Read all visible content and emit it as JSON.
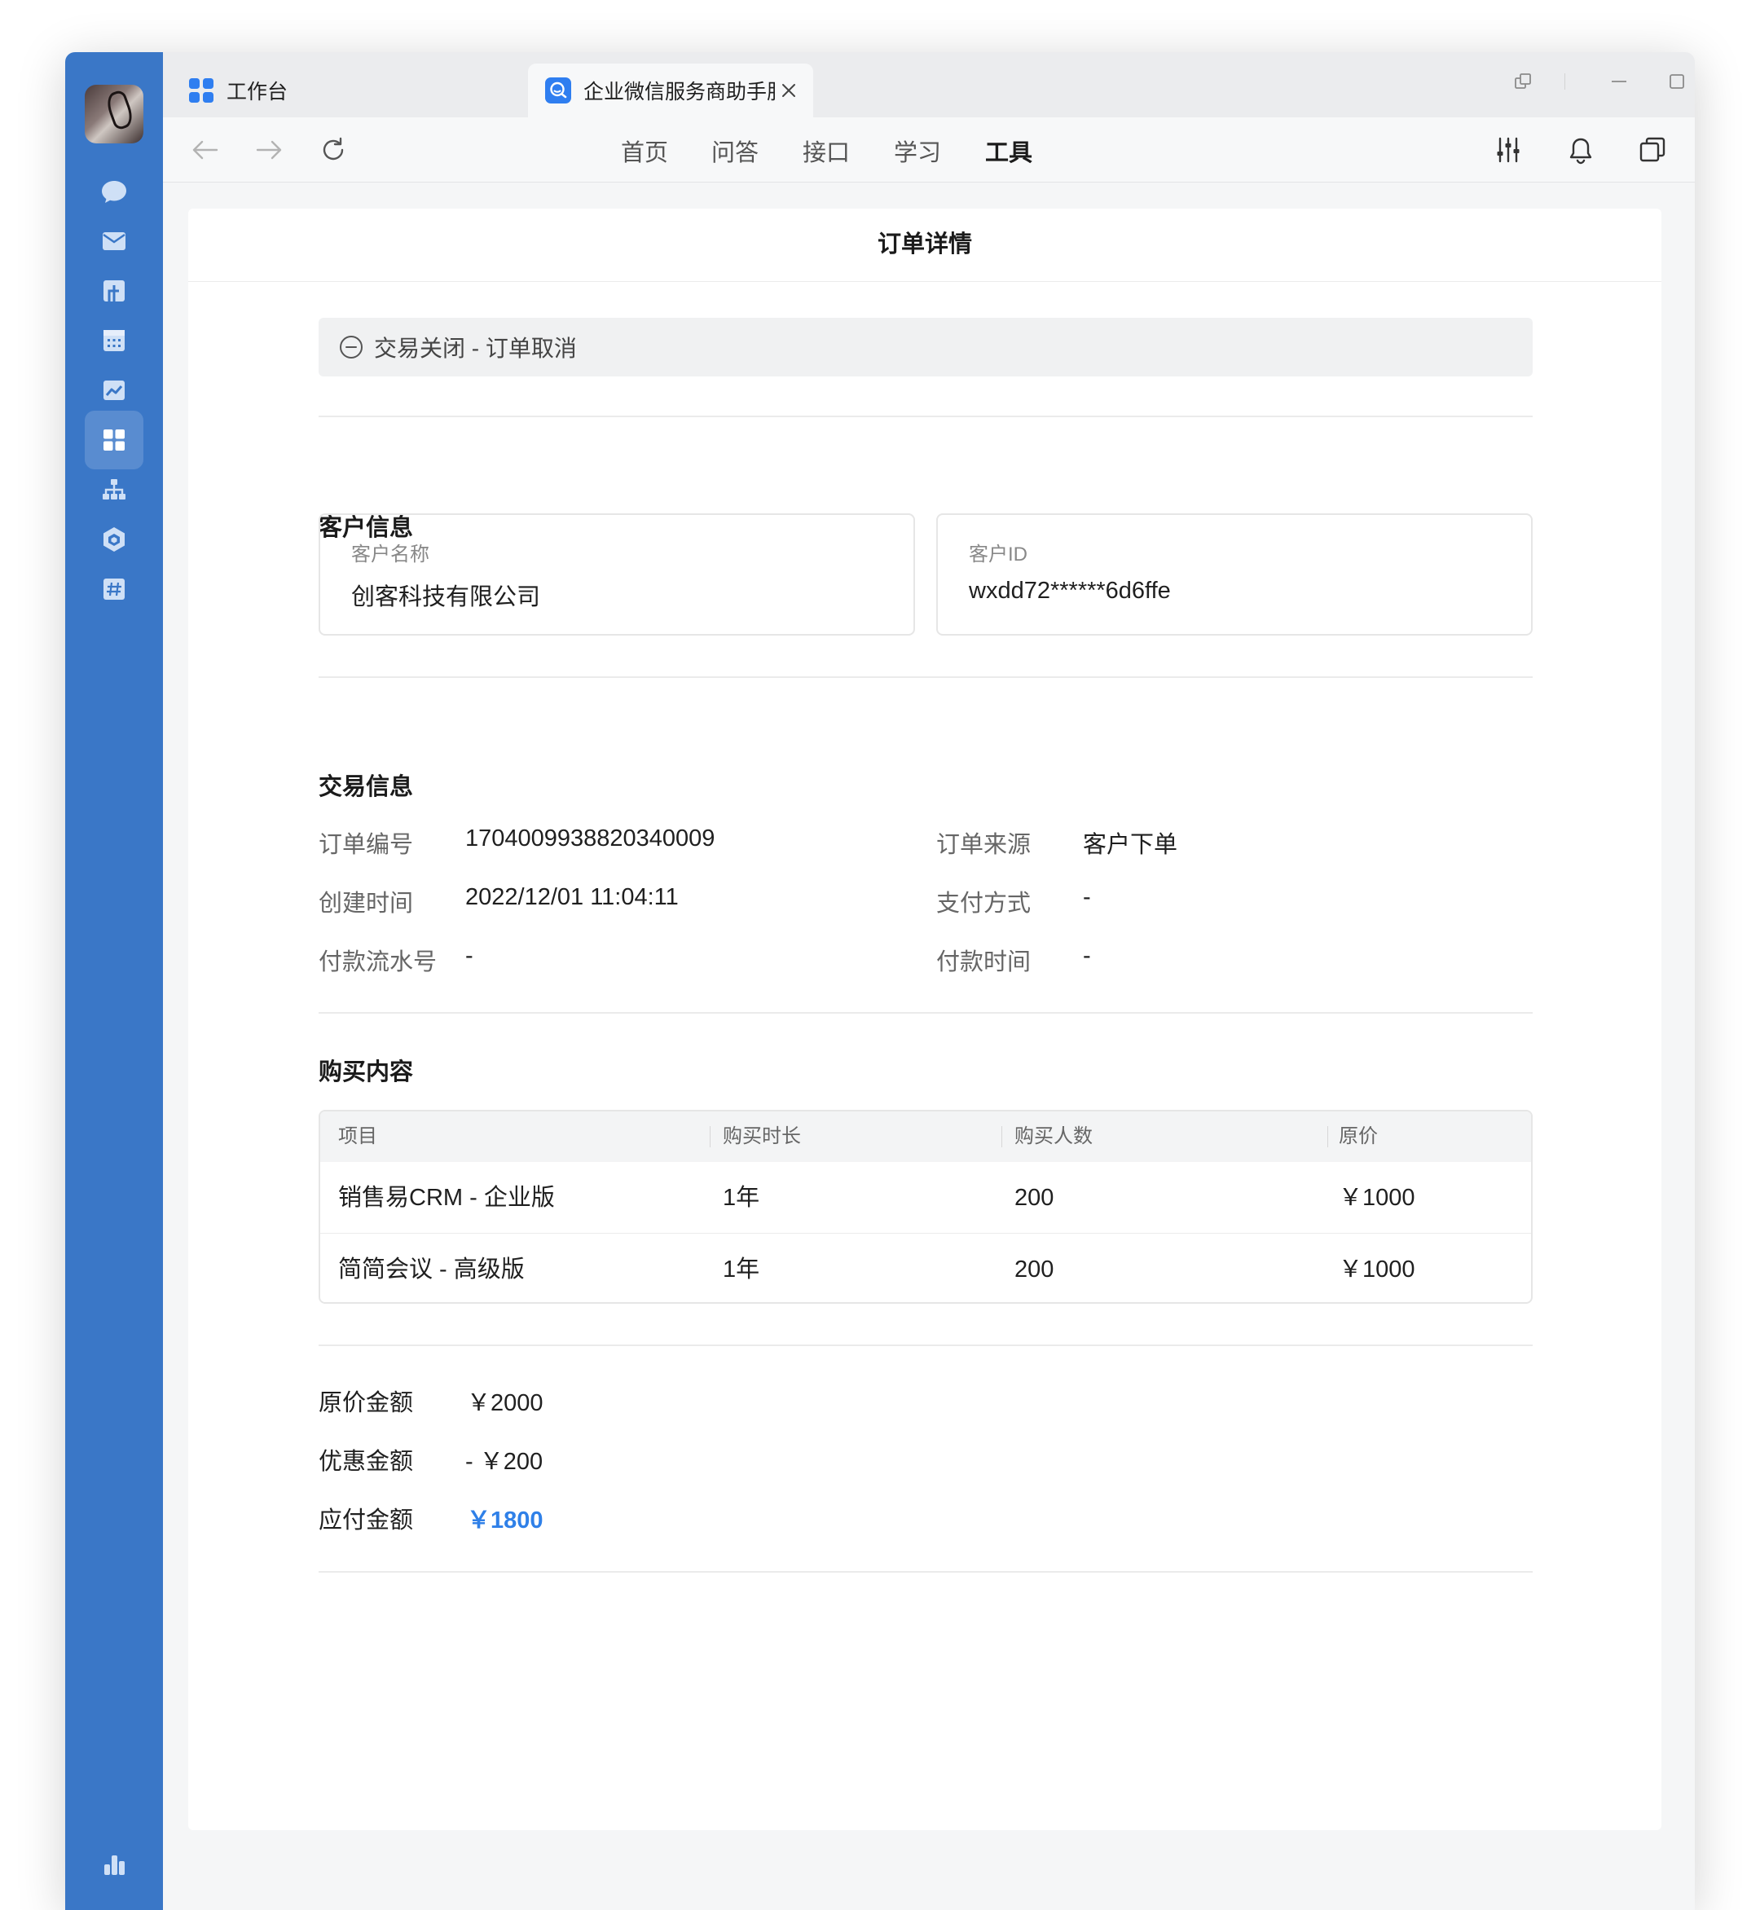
{
  "tabs": [
    {
      "label": "工作台",
      "icon": "grid-icon"
    },
    {
      "label": "企业微信服务商助手服",
      "icon": "assistant-icon"
    }
  ],
  "sidebar_icons": [
    "chat-icon",
    "mail-icon",
    "docs-icon",
    "calendar-icon",
    "cloud-drive-icon",
    "workbench-icon",
    "org-chart-icon",
    "box-icon",
    "hashtag-icon",
    "stats-icon"
  ],
  "nav": {
    "links": [
      "首页",
      "问答",
      "接口",
      "学习",
      "工具"
    ],
    "active": "工具"
  },
  "page": {
    "title": "订单详情",
    "status": "交易关闭 - 订单取消"
  },
  "customer": {
    "section_title": "客户信息",
    "name_label": "客户名称",
    "name_value": "创客科技有限公司",
    "id_label": "客户ID",
    "id_value": "wxdd72******6d6ffe"
  },
  "transaction": {
    "section_title": "交易信息",
    "fields": [
      {
        "label": "订单编号",
        "value": "1704009938820340009"
      },
      {
        "label": "订单来源",
        "value": "客户下单"
      },
      {
        "label": "创建时间",
        "value": "2022/12/01 11:04:11"
      },
      {
        "label": "支付方式",
        "value": "-"
      },
      {
        "label": "付款流水号",
        "value": "-"
      },
      {
        "label": "付款时间",
        "value": "-"
      }
    ]
  },
  "purchase": {
    "section_title": "购买内容",
    "columns": [
      "项目",
      "购买时长",
      "购买人数",
      "原价"
    ],
    "rows": [
      [
        "销售易CRM - 企业版",
        "1年",
        "200",
        "￥1000"
      ],
      [
        "简简会议 - 高级版",
        "1年",
        "200",
        "￥1000"
      ]
    ]
  },
  "amounts": [
    {
      "label": "原价金额",
      "value": "￥2000"
    },
    {
      "label": "优惠金额",
      "value": "- ￥200"
    },
    {
      "label": "应付金额",
      "value": "￥1800"
    }
  ],
  "colors": {
    "sidebar": "#3a77c7",
    "accent": "#2f80e8"
  }
}
